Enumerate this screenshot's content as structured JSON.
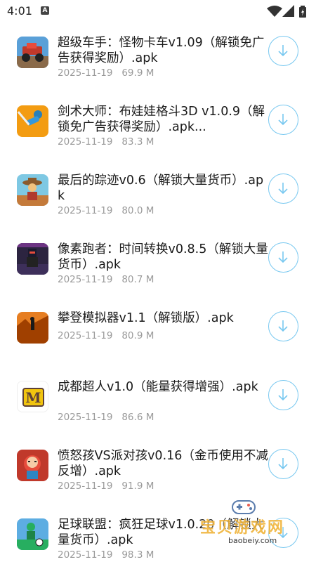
{
  "status_bar": {
    "time": "4:01",
    "notification_glyph": "A"
  },
  "items": [
    {
      "title": "超级车手：怪物卡车v1.09（解锁免广告获得奖励）.apk",
      "date": "2025-11-19",
      "size": "69.9 M",
      "icon": "monster-truck-game-icon"
    },
    {
      "title": "剑术大师：布娃娃格斗3D v1.0.9（解锁免广告获得奖励）.apk...",
      "date": "2025-11-19",
      "size": "83.3 M",
      "icon": "ragdoll-sword-game-icon"
    },
    {
      "title": "最后的踪迹v0.6（解锁大量货币）.apk",
      "date": "2025-11-19",
      "size": "80.0 M",
      "icon": "cowboy-game-icon"
    },
    {
      "title": "像素跑者：时间转换v0.8.5（解锁大量货币）.apk",
      "date": "2025-11-19",
      "size": "80.7 M",
      "icon": "pixel-runner-game-icon"
    },
    {
      "title": "攀登模拟器v1.1（解锁版）.apk",
      "date": "2025-11-19",
      "size": "80.9 M",
      "icon": "climbing-game-icon"
    },
    {
      "title": "成都超人v1.0（能量获得增强）.apk",
      "date": "2025-11-19",
      "size": "86.6 M",
      "icon": "m-letter-game-icon"
    },
    {
      "title": "愤怒孩VS派对孩v0.16（金币使用不减反增）.apk",
      "date": "2025-11-19",
      "size": "91.9 M",
      "icon": "angry-kid-game-icon"
    },
    {
      "title": "足球联盟：疯狂足球v1.0.20（解锁大量货币）.apk",
      "date": "2025-11-19",
      "size": "98.3 M",
      "icon": "soccer-game-icon"
    }
  ],
  "watermark": {
    "text": "宝贝游戏网",
    "url": "baobeiy.com"
  },
  "colors": {
    "accent": "#78c8f0",
    "meta": "#9a9a9a",
    "title": "#1a1a1a",
    "watermark": "#f0b43a"
  }
}
